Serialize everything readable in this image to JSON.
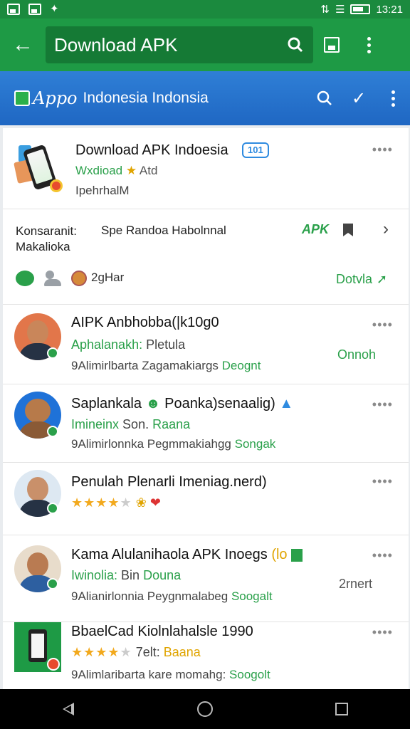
{
  "status_bar": {
    "time": "13:21"
  },
  "toolbar": {
    "title": "Download APK"
  },
  "subheader": {
    "logo_script": "Appo",
    "title": "Indonesia Indonsia"
  },
  "app": {
    "title": "Download APK Indoesia",
    "tag": "101",
    "subtitle": "Wxdioad",
    "subtitle_extra": "Atd",
    "developer": "IpehrhalМ"
  },
  "info": {
    "label": "Konsaranit: Makalioka",
    "description": "Spe Randoa Habolnnal",
    "apk_label": "APK",
    "user_count": "2gHar",
    "link": "Dotvla"
  },
  "list": [
    {
      "title": "AIPK Anbhobba(|k10g0",
      "sub": "Aphalanakh:",
      "sub_plain": "Pletula",
      "meta": "9Alimirlbarta Zagamakiargs",
      "meta_hl": "Deognt",
      "side": "Onnoh"
    },
    {
      "title": "Saplankala",
      "title_rest": "Poanka)senaalig)",
      "sub": "Imineinx",
      "sub_plain": "Son.",
      "sub_rest": "Raana",
      "meta": "9Alimirlonnka Pegmmakiahgg",
      "meta_hl": "Songak"
    },
    {
      "title": "Penulah Plenarli Imeniag.nerd)",
      "stars": "★★★★"
    },
    {
      "title": "Kama Alulanihaola APK Inoegs",
      "title_badge": "(lo",
      "sub": "Iwinolia:",
      "sub_plain": "Bin",
      "sub_rest": "Douna",
      "meta": "9Alianirlonnia Peygnmalabeg",
      "meta_hl": "Soogalt",
      "side": "2rnert"
    },
    {
      "title": "BbaelCad Kiolnlahalsle 1990",
      "stars": "★★★★",
      "sub_plain": "7elt:",
      "sub_rest": "Baana",
      "meta": "9Alimlaribarta kare momahg:",
      "meta_hl": "Soogolt"
    }
  ],
  "colors": {
    "primary_green": "#1e9a45",
    "status_green": "#1b8a3e",
    "header_blue": "#1f67c3",
    "accent_green": "#2aa04a"
  }
}
